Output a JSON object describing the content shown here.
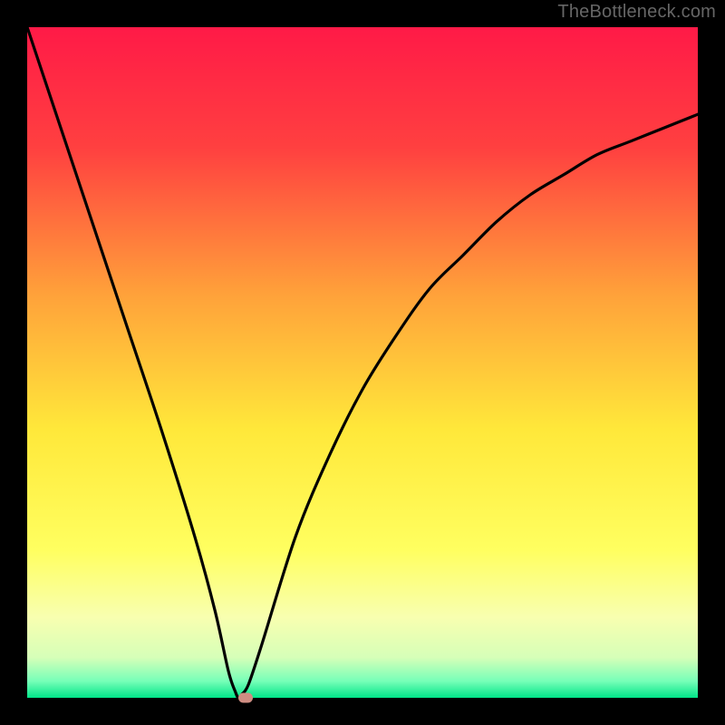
{
  "watermark": "TheBottleneck.com",
  "chart_data": {
    "type": "line",
    "title": "",
    "xlabel": "",
    "ylabel": "",
    "xlim": [
      0,
      1
    ],
    "ylim": [
      0,
      1
    ],
    "grid": false,
    "legend": false,
    "background_gradient": {
      "stops": [
        {
          "pos": 0.0,
          "color": "#ff1a47"
        },
        {
          "pos": 0.18,
          "color": "#ff4040"
        },
        {
          "pos": 0.4,
          "color": "#ffa23a"
        },
        {
          "pos": 0.6,
          "color": "#ffe83a"
        },
        {
          "pos": 0.78,
          "color": "#ffff60"
        },
        {
          "pos": 0.88,
          "color": "#f8ffb0"
        },
        {
          "pos": 0.94,
          "color": "#d6ffb8"
        },
        {
          "pos": 0.975,
          "color": "#77ffb8"
        },
        {
          "pos": 1.0,
          "color": "#00e588"
        }
      ]
    },
    "series": [
      {
        "name": "bottleneck-curve",
        "color": "#000000",
        "x": [
          0.0,
          0.05,
          0.1,
          0.15,
          0.2,
          0.25,
          0.28,
          0.3,
          0.31,
          0.315,
          0.32,
          0.33,
          0.35,
          0.4,
          0.45,
          0.5,
          0.55,
          0.6,
          0.65,
          0.7,
          0.75,
          0.8,
          0.85,
          0.9,
          0.95,
          1.0
        ],
        "y": [
          1.0,
          0.85,
          0.7,
          0.55,
          0.4,
          0.24,
          0.13,
          0.04,
          0.01,
          0.0,
          0.005,
          0.02,
          0.08,
          0.24,
          0.36,
          0.46,
          0.54,
          0.61,
          0.66,
          0.71,
          0.75,
          0.78,
          0.81,
          0.83,
          0.85,
          0.87
        ]
      }
    ],
    "marker": {
      "x": 0.325,
      "y": 0.0,
      "color": "#cf8d82"
    }
  }
}
